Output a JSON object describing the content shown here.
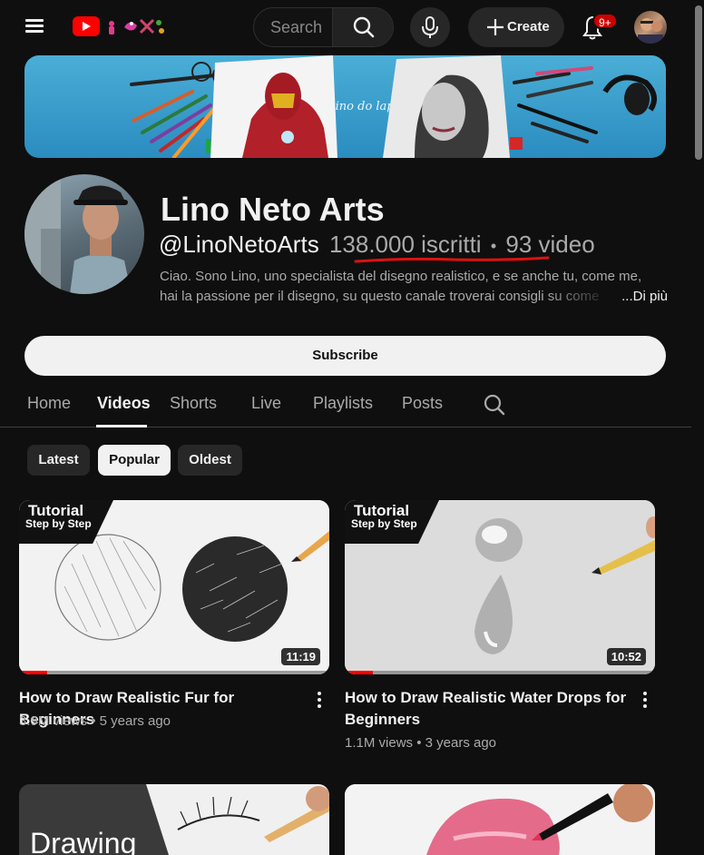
{
  "header": {
    "search_placeholder": "Search",
    "create_label": "Create",
    "notifications_badge": "9+"
  },
  "channel": {
    "name": "Lino Neto Arts",
    "handle": "@LinoNetoArts",
    "subscribers": "138.000 iscritti",
    "separator": "•",
    "videos": "93 video",
    "description_line1": "Ciao. Sono Lino, uno specialista del disegno realistico, e se anche tu, come me,",
    "description_line2": "hai la passione per il disegno, su questo canale troverai consigli su come",
    "more_label": "...Di più",
    "subscribe_label": "Subscribe",
    "banner_signature": "Lino do lapis"
  },
  "tabs": [
    {
      "label": "Home"
    },
    {
      "label": "Videos"
    },
    {
      "label": "Shorts"
    },
    {
      "label": "Live"
    },
    {
      "label": "Playlists"
    },
    {
      "label": "Posts"
    }
  ],
  "active_tab": "Videos",
  "chips": [
    {
      "label": "Latest"
    },
    {
      "label": "Popular"
    },
    {
      "label": "Oldest"
    }
  ],
  "active_chip": "Popular",
  "videos": [
    {
      "title": "How to Draw Realistic Fur for Beginners",
      "views": "3.9M views",
      "age": "5 years ago",
      "duration": "11:19",
      "badge_top": "Tutorial",
      "badge_bottom": "Step by Step",
      "watched_progress": 0.09
    },
    {
      "title": "How to Draw Realistic Water Drops for Beginners",
      "views": "1.1M views",
      "age": "3 years ago",
      "duration": "10:52",
      "badge_top": "Tutorial",
      "badge_bottom": "Step by Step",
      "watched_progress": 0.09
    }
  ],
  "partial_thumbs": [
    {
      "overlay_text": "Drawing"
    }
  ],
  "colors": {
    "background": "#0f0f0f",
    "text": "#f1f1f1",
    "secondary_text": "#aaaaaa",
    "accent_red": "#ff0000",
    "underline_red": "#e01010"
  }
}
